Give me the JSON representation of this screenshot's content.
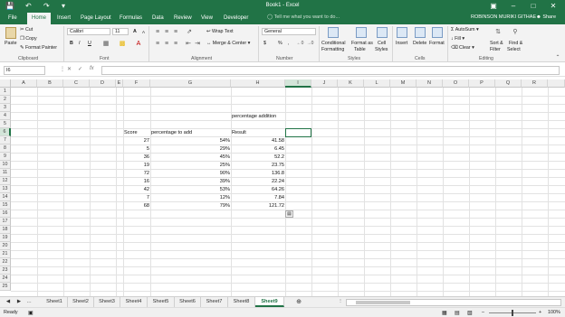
{
  "window": {
    "title": "Book1 - Excel",
    "user": "ROBINSON MURIKI GITHAE",
    "share": "Share"
  },
  "tabs": [
    "File",
    "Home",
    "Insert",
    "Page Layout",
    "Formulas",
    "Data",
    "Review",
    "View",
    "Developer"
  ],
  "active_tab": "Home",
  "tell_me": "Tell me what you want to do...",
  "ribbon": {
    "clipboard": {
      "paste": "Paste",
      "cut": "Cut",
      "copy": "Copy",
      "format_painter": "Format Painter",
      "group": "Clipboard"
    },
    "font": {
      "name": "Calibri",
      "size": "11",
      "bold": "B",
      "italic": "I",
      "underline": "U",
      "grow": "A",
      "shrink": "A",
      "group": "Font"
    },
    "alignment": {
      "wrap": "Wrap Text",
      "merge": "Merge & Center",
      "group": "Alignment"
    },
    "number": {
      "format": "General",
      "currency": "$",
      "percent": "%",
      "comma": ",",
      "group": "Number"
    },
    "styles": {
      "conditional": "Conditional",
      "conditional2": "Formatting",
      "format_table": "Format as",
      "format_table2": "Table",
      "cell_styles": "Cell",
      "cell_styles2": "Styles",
      "group": "Styles"
    },
    "cells": {
      "insert": "Insert",
      "delete": "Delete",
      "format": "Format",
      "group": "Cells"
    },
    "editing": {
      "autosum": "AutoSum",
      "fill": "Fill",
      "clear": "Clear",
      "sort": "Sort &",
      "sort2": "Filter",
      "find": "Find &",
      "find2": "Select",
      "group": "Editing"
    }
  },
  "formula_bar": {
    "name_box": "I6",
    "fx": "fx",
    "value": ""
  },
  "columns": [
    "A",
    "B",
    "C",
    "D",
    "E",
    "F",
    "G",
    "H",
    "I",
    "J",
    "K",
    "L",
    "M",
    "N",
    "O",
    "P",
    "Q",
    "R"
  ],
  "rows": [
    "1",
    "2",
    "3",
    "4",
    "5",
    "6",
    "7",
    "8",
    "9",
    "10",
    "11",
    "12",
    "13",
    "14",
    "15",
    "16",
    "17",
    "18",
    "19",
    "20",
    "21",
    "22",
    "23",
    "24",
    "25"
  ],
  "sheet": {
    "title": "percentage addition",
    "headers": {
      "score": "Score",
      "pct": "percentage to add",
      "result": "Result"
    },
    "data": [
      {
        "score": "27",
        "pct": "54%",
        "result": "41.58"
      },
      {
        "score": "5",
        "pct": "29%",
        "result": "6.45"
      },
      {
        "score": "36",
        "pct": "45%",
        "result": "52.2"
      },
      {
        "score": "19",
        "pct": "25%",
        "result": "23.75"
      },
      {
        "score": "72",
        "pct": "90%",
        "result": "136.8"
      },
      {
        "score": "16",
        "pct": "39%",
        "result": "22.24"
      },
      {
        "score": "42",
        "pct": "53%",
        "result": "64.26"
      },
      {
        "score": "7",
        "pct": "12%",
        "result": "7.84"
      },
      {
        "score": "68",
        "pct": "79%",
        "result": "121.72"
      }
    ]
  },
  "sheet_tabs": [
    "Sheet1",
    "Sheet2",
    "Sheet3",
    "Sheet4",
    "Sheet5",
    "Sheet6",
    "Sheet7",
    "Sheet8",
    "Sheet9"
  ],
  "active_sheet": "Sheet9",
  "status": {
    "ready": "Ready",
    "zoom": "100%"
  }
}
